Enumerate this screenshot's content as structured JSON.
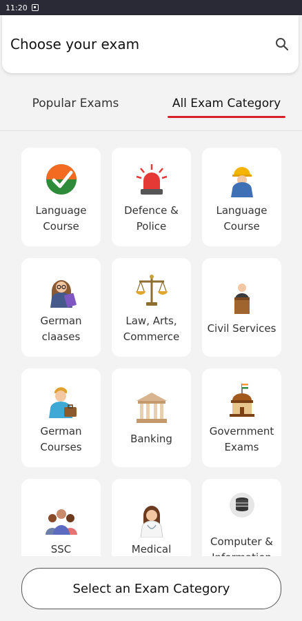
{
  "status_bar": {
    "time": "11:20"
  },
  "header": {
    "title": "Choose your exam",
    "search_icon": "search-icon"
  },
  "tabs": [
    {
      "label": "Popular Exams",
      "active": false
    },
    {
      "label": "All Exam Category",
      "active": true
    }
  ],
  "accent_color": "#d8202a",
  "categories": [
    {
      "label": "Language Course",
      "icon": "checkmark-badge-icon"
    },
    {
      "label": "Defence & Police",
      "icon": "siren-icon"
    },
    {
      "label": "Language Course",
      "icon": "worker-icon"
    },
    {
      "label": "German claases",
      "icon": "teacher-icon"
    },
    {
      "label": "Law, Arts, Commerce",
      "icon": "scales-icon"
    },
    {
      "label": "Civil Services",
      "icon": "speaker-podium-icon"
    },
    {
      "label": "German Courses",
      "icon": "businessman-icon"
    },
    {
      "label": "Banking",
      "icon": "bank-icon"
    },
    {
      "label": "Government Exams",
      "icon": "government-building-icon"
    },
    {
      "label": "SSC",
      "icon": "group-icon"
    },
    {
      "label": "Medical",
      "icon": "doctor-icon"
    },
    {
      "label": "Computer & Information",
      "icon": "database-icon"
    }
  ],
  "bottom_button": {
    "label": "Select an Exam Category"
  }
}
